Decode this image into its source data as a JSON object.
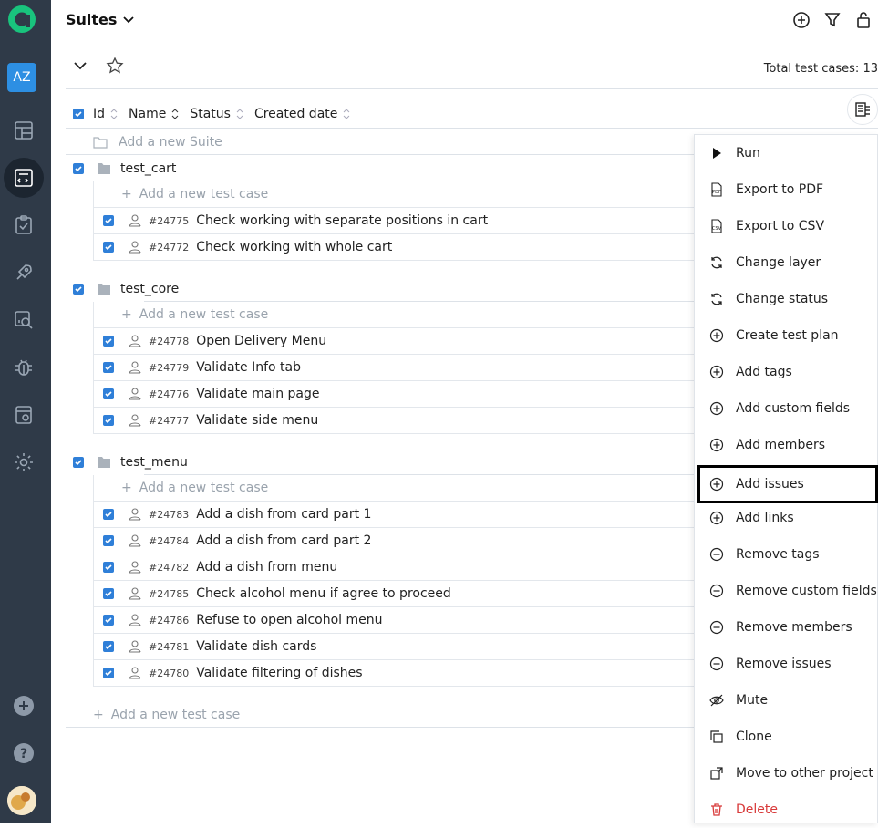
{
  "sidebar": {
    "workspace_initials": "AZ",
    "items": [
      {
        "name": "dashboard",
        "icon": "dashboard-icon"
      },
      {
        "name": "suites",
        "icon": "suites-icon",
        "active": true
      },
      {
        "name": "plans",
        "icon": "clipboard-check-icon"
      },
      {
        "name": "runs",
        "icon": "rocket-icon"
      },
      {
        "name": "analytics",
        "icon": "analytics-icon"
      },
      {
        "name": "defects",
        "icon": "bug-icon"
      },
      {
        "name": "runs-history",
        "icon": "history-icon"
      },
      {
        "name": "settings",
        "icon": "gear-icon"
      }
    ],
    "bottom": [
      {
        "icon": "plus-icon"
      },
      {
        "icon": "help-icon"
      }
    ]
  },
  "header": {
    "title": "Suites",
    "total_label": "Total test cases: 13"
  },
  "table": {
    "columns": [
      "Id",
      "Name",
      "Status",
      "Created date"
    ],
    "add_suite": "Add a new Suite",
    "add_case": "Add a new test case",
    "suites": [
      {
        "name": "test_cart",
        "cases": [
          {
            "id": "#24775",
            "title": "Check working with separate positions in cart"
          },
          {
            "id": "#24772",
            "title": "Check working with whole cart"
          }
        ]
      },
      {
        "name": "test_core",
        "cases": [
          {
            "id": "#24778",
            "title": "Open Delivery Menu"
          },
          {
            "id": "#24779",
            "title": "Validate Info tab"
          },
          {
            "id": "#24776",
            "title": "Validate main page"
          },
          {
            "id": "#24777",
            "title": "Validate side menu"
          }
        ]
      },
      {
        "name": "test_menu",
        "cases": [
          {
            "id": "#24783",
            "title": "Add a dish from card part 1"
          },
          {
            "id": "#24784",
            "title": "Add a dish from card part 2"
          },
          {
            "id": "#24782",
            "title": "Add a dish from menu"
          },
          {
            "id": "#24785",
            "title": "Check alcohol menu if agree to proceed"
          },
          {
            "id": "#24786",
            "title": "Refuse to open alcohol menu"
          },
          {
            "id": "#24781",
            "title": "Validate dish cards"
          },
          {
            "id": "#24780",
            "title": "Validate filtering of dishes"
          }
        ]
      }
    ]
  },
  "menu": {
    "items": [
      {
        "label": "Run",
        "icon": "play-icon"
      },
      {
        "label": "Export to PDF",
        "icon": "pdf-icon"
      },
      {
        "label": "Export to CSV",
        "icon": "csv-icon"
      },
      {
        "label": "Change layer",
        "icon": "refresh-icon"
      },
      {
        "label": "Change status",
        "icon": "refresh-icon"
      },
      {
        "label": "Create test plan",
        "icon": "plus-circle-icon"
      },
      {
        "label": "Add tags",
        "icon": "plus-circle-icon"
      },
      {
        "label": "Add custom fields",
        "icon": "plus-circle-icon"
      },
      {
        "label": "Add members",
        "icon": "plus-circle-icon"
      },
      {
        "label": "Add issues",
        "icon": "plus-circle-icon",
        "selected": true
      },
      {
        "label": "Add links",
        "icon": "plus-circle-icon"
      },
      {
        "label": "Remove tags",
        "icon": "minus-circle-icon"
      },
      {
        "label": "Remove custom fields",
        "icon": "minus-circle-icon"
      },
      {
        "label": "Remove members",
        "icon": "minus-circle-icon"
      },
      {
        "label": "Remove issues",
        "icon": "minus-circle-icon"
      },
      {
        "label": "Mute",
        "icon": "eye-off-icon"
      },
      {
        "label": "Clone",
        "icon": "clone-icon"
      },
      {
        "label": "Move to other project",
        "icon": "move-icon"
      },
      {
        "label": "Delete",
        "icon": "trash-icon",
        "danger": true
      }
    ]
  },
  "colors": {
    "sidebar": "#2f3a48",
    "accent": "#2f7fd8",
    "danger": "#d83a3a",
    "brand": "#19c37d"
  }
}
